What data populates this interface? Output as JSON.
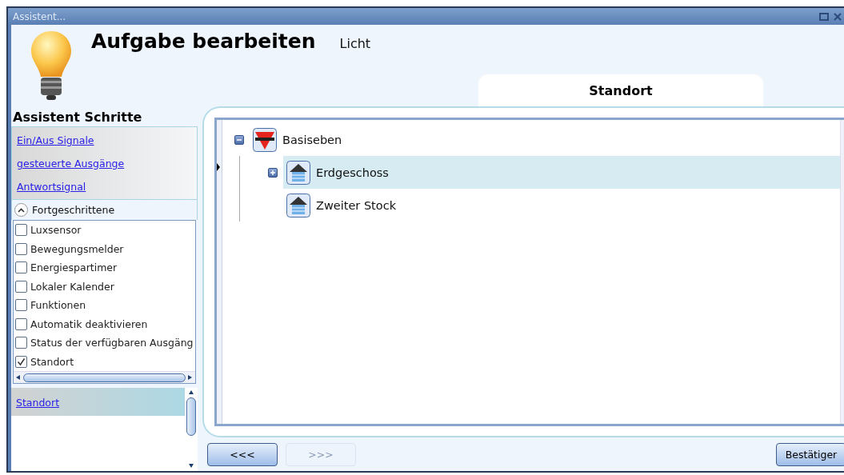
{
  "window": {
    "title": "Assistent..."
  },
  "header": {
    "title": "Aufgabe bearbeiten",
    "subtitle": "Licht"
  },
  "tab": {
    "label": "Standort",
    "selected": true
  },
  "sidebar": {
    "heading": "Assistent Schritte",
    "links": [
      "Ein/Aus Signale",
      "gesteuerte Ausgänge",
      "Antwortsignal"
    ],
    "advanced": {
      "label": "Fortgeschrittene",
      "expanded": true,
      "items": [
        {
          "label": "Luxsensor",
          "checked": false
        },
        {
          "label": "Bewegungsmelder",
          "checked": false
        },
        {
          "label": "Energiespartimer",
          "checked": false
        },
        {
          "label": "Lokaler Kalender",
          "checked": false
        },
        {
          "label": "Funktionen",
          "checked": false
        },
        {
          "label": "Automatik deaktivieren",
          "checked": false
        },
        {
          "label": "Status der verfügbaren Ausgäng",
          "checked": false
        },
        {
          "label": "Standort",
          "checked": true
        }
      ]
    },
    "current_steps": [
      "Standort"
    ]
  },
  "tree": [
    {
      "label": "Basiseben",
      "kind": "root",
      "expanded": true,
      "selected": false,
      "children": [
        {
          "label": "Erdgeschoss",
          "kind": "floor",
          "expanded": false,
          "selected": true
        },
        {
          "label": "Zweiter Stock",
          "kind": "floor",
          "selected": false
        }
      ]
    }
  ],
  "buttons": [
    {
      "label": "<<<",
      "disabled": false
    },
    {
      "label": ">>>",
      "disabled": true
    },
    {
      "label": "Bestätiger",
      "disabled": false
    }
  ]
}
